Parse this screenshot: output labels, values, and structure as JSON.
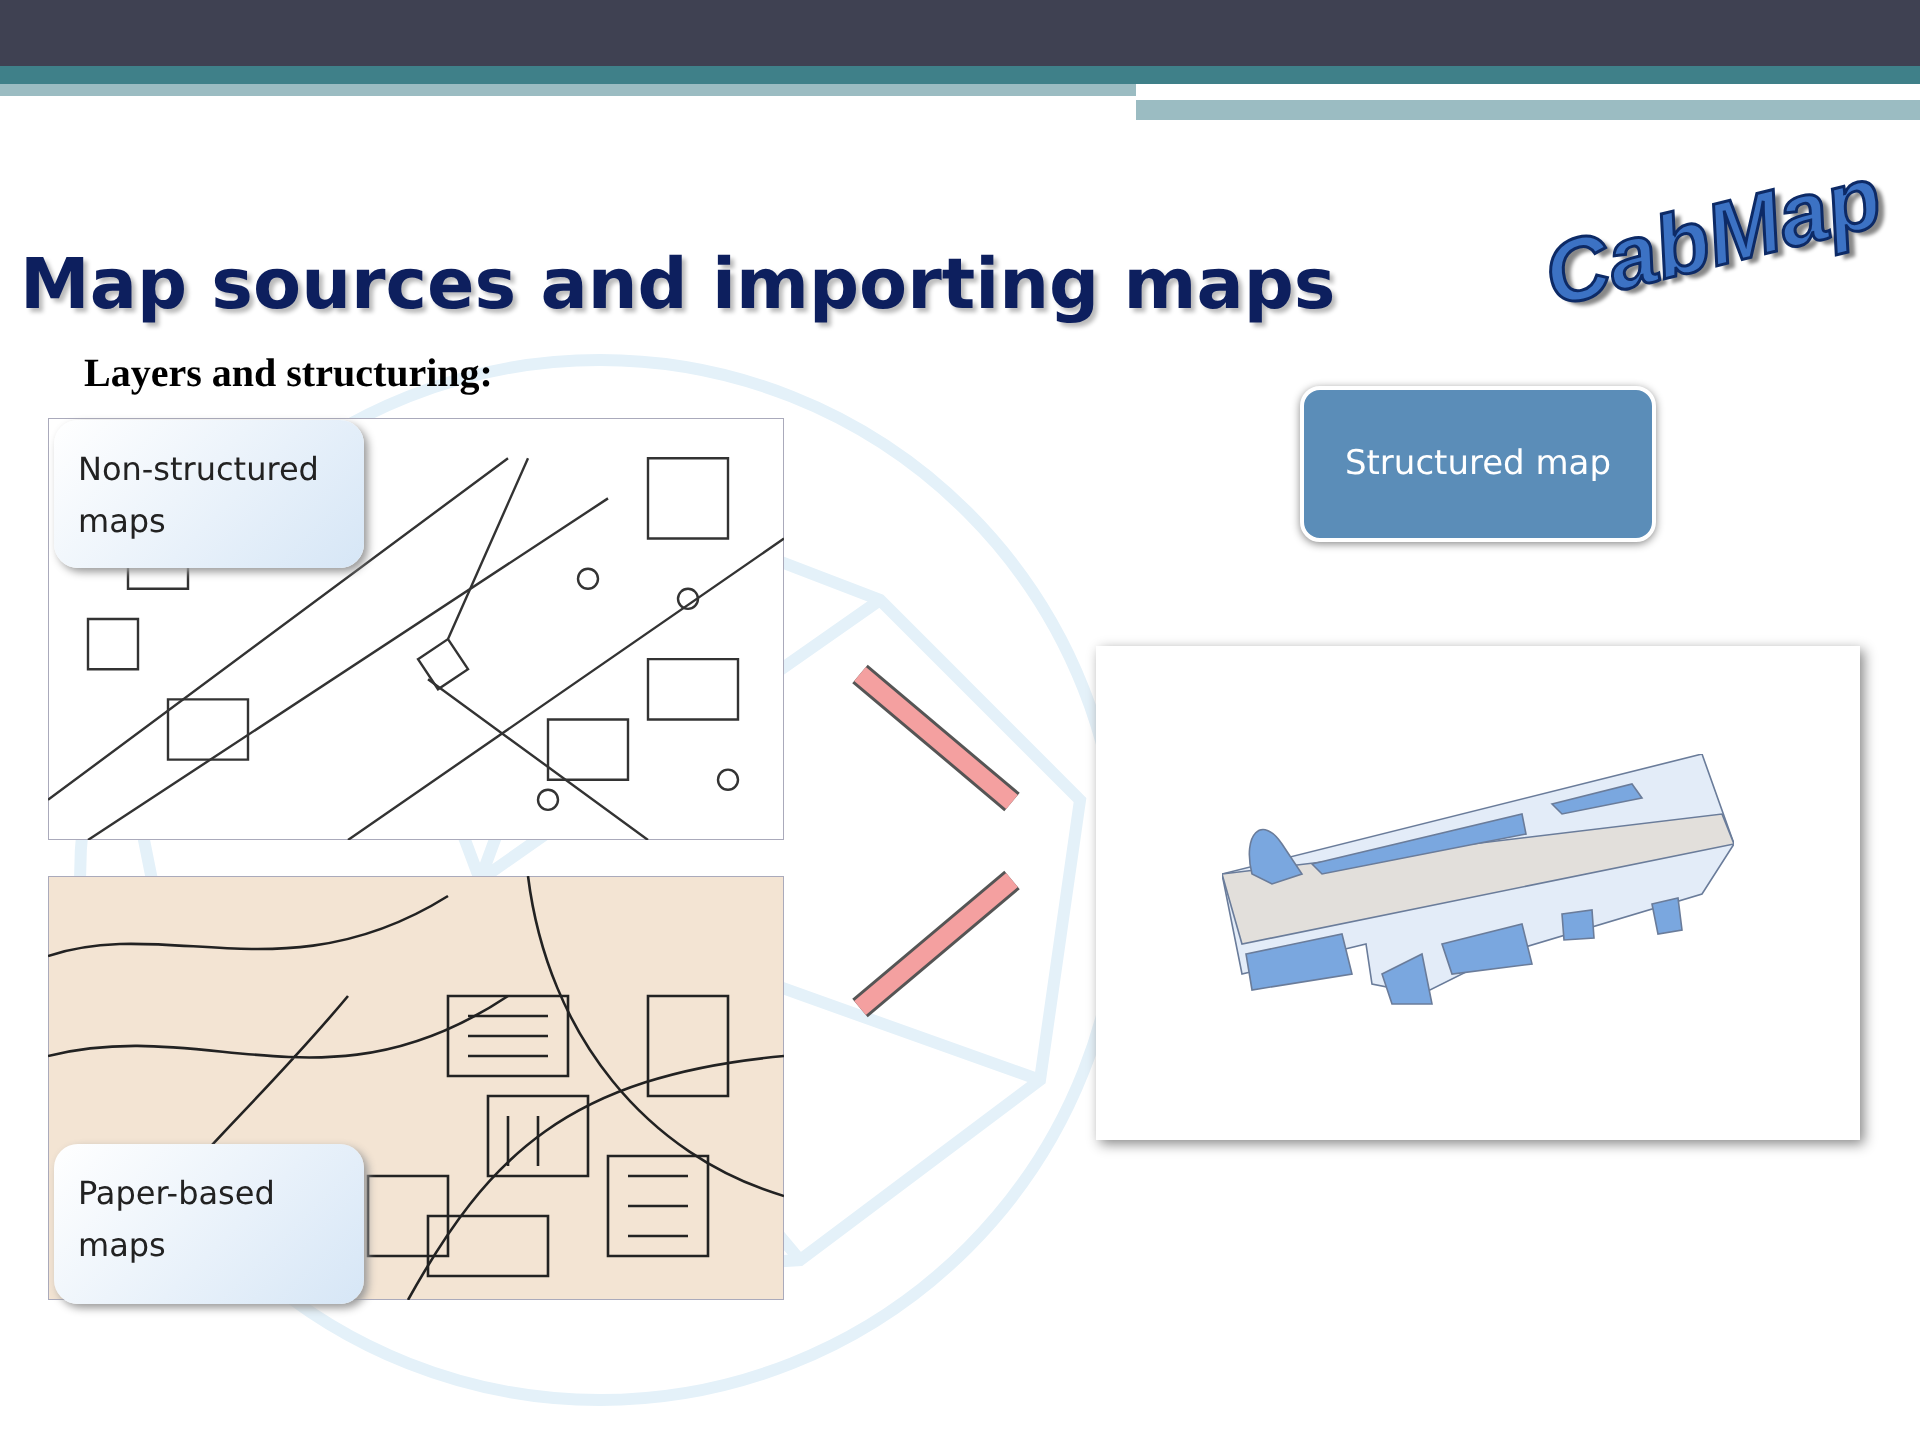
{
  "title": "Map sources and importing maps",
  "logo": "CabMap",
  "subtitle": "Layers and structuring:",
  "sources": [
    {
      "label": "Non-structured maps",
      "kind": "street"
    },
    {
      "label": "Paper-based maps",
      "kind": "paper"
    }
  ],
  "result": {
    "label": "Structured map"
  }
}
